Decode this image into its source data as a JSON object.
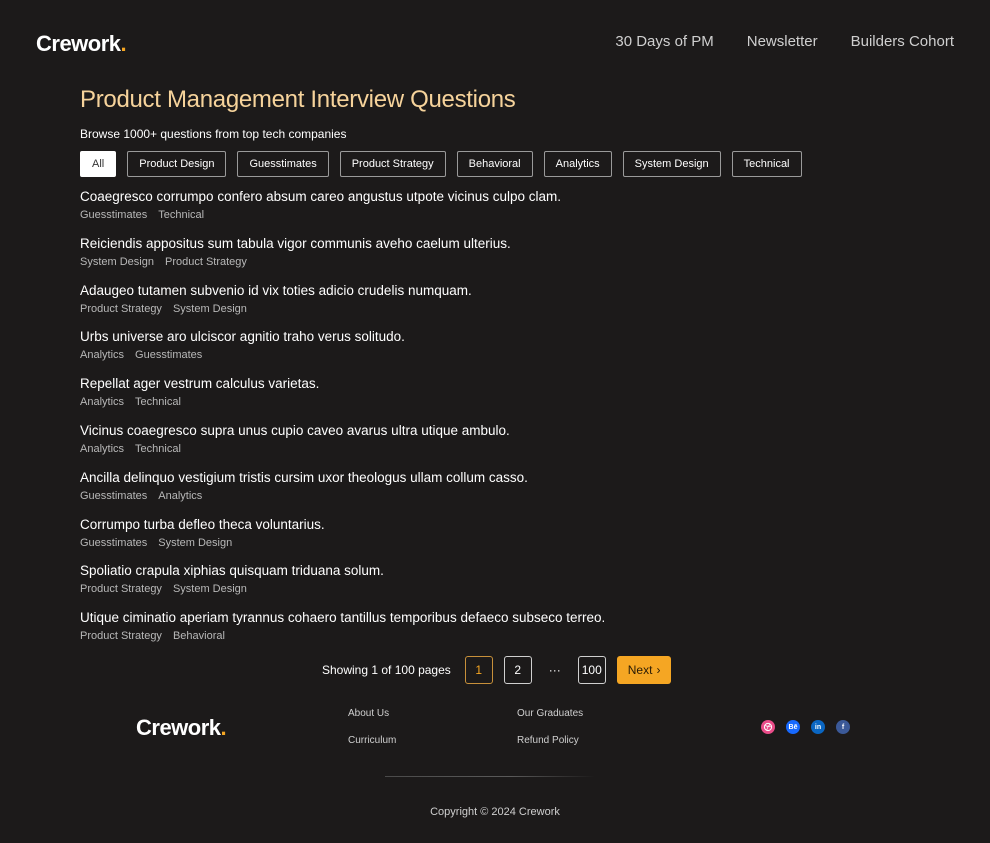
{
  "header": {
    "logo_text": "Crework",
    "logo_dot": ".",
    "nav": [
      "30 Days of PM",
      "Newsletter",
      "Builders Cohort"
    ]
  },
  "main": {
    "title": "Product Management Interview Questions",
    "subtitle": "Browse 1000+ questions from top tech companies",
    "filters": [
      "All",
      "Product Design",
      "Guesstimates",
      "Product Strategy",
      "Behavioral",
      "Analytics",
      "System Design",
      "Technical"
    ],
    "active_filter": "All",
    "questions": [
      {
        "title": "Coaegresco corrumpo confero absum careo angustus utpote vicinus culpo clam.",
        "tags": [
          "Guesstimates",
          "Technical"
        ]
      },
      {
        "title": "Reiciendis appositus sum tabula vigor communis aveho caelum ulterius.",
        "tags": [
          "System Design",
          "Product Strategy"
        ]
      },
      {
        "title": "Adaugeo tutamen subvenio id vix toties adicio crudelis numquam.",
        "tags": [
          "Product Strategy",
          "System Design"
        ]
      },
      {
        "title": "Urbs universe aro ulciscor agnitio traho verus solitudo.",
        "tags": [
          "Analytics",
          "Guesstimates"
        ]
      },
      {
        "title": "Repellat ager vestrum calculus varietas.",
        "tags": [
          "Analytics",
          "Technical"
        ]
      },
      {
        "title": "Vicinus coaegresco supra unus cupio caveo avarus ultra utique ambulo.",
        "tags": [
          "Analytics",
          "Technical"
        ]
      },
      {
        "title": "Ancilla delinquo vestigium tristis cursim uxor theologus ullam collum casso.",
        "tags": [
          "Guesstimates",
          "Analytics"
        ]
      },
      {
        "title": "Corrumpo turba defleo theca voluntarius.",
        "tags": [
          "Guesstimates",
          "System Design"
        ]
      },
      {
        "title": "Spoliatio crapula xiphias quisquam triduana solum.",
        "tags": [
          "Product Strategy",
          "System Design"
        ]
      },
      {
        "title": "Utique ciminatio aperiam tyrannus cohaero tantillus temporibus defaeco subseco terreo.",
        "tags": [
          "Product Strategy",
          "Behavioral"
        ]
      }
    ]
  },
  "pagination": {
    "showing_text": "Showing 1 of 100 pages",
    "pages": [
      "1",
      "2"
    ],
    "ellipsis": "···",
    "last_page": "100",
    "current": "1",
    "next_label": "Next",
    "next_icon": "›"
  },
  "footer": {
    "logo_text": "Crework",
    "logo_dot": ".",
    "links_col1": [
      "About Us",
      "Curriculum"
    ],
    "links_col2": [
      "Our Graduates",
      "Refund Policy"
    ],
    "socials": [
      {
        "name": "dribbble-icon",
        "color": "#ea4c89",
        "glyph": "◎"
      },
      {
        "name": "behance-icon",
        "color": "#1769ff",
        "glyph": "Bē"
      },
      {
        "name": "linkedin-icon",
        "color": "#0a66c2",
        "glyph": "in"
      },
      {
        "name": "facebook-icon",
        "color": "#3b5998",
        "glyph": "f"
      }
    ],
    "copyright": "Copyright © 2024 Crework"
  },
  "colors": {
    "background": "#1c1a1a",
    "accent": "#f5a623",
    "title": "#f6d39b"
  }
}
